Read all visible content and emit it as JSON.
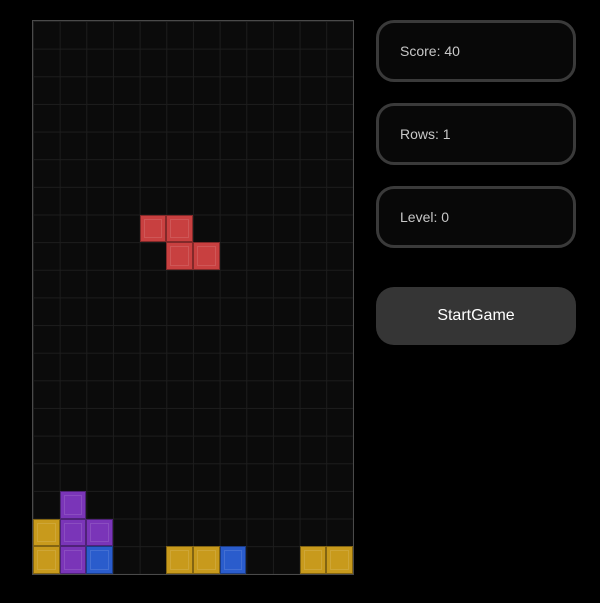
{
  "board": {
    "columns": 12,
    "rows": 20,
    "grid_lines": true,
    "active_piece": {
      "shape": "Z",
      "color": "#c84040",
      "cells": [
        [
          4,
          7
        ],
        [
          5,
          7
        ],
        [
          5,
          8
        ],
        [
          6,
          8
        ]
      ]
    },
    "settled_cells": [
      {
        "col": 1,
        "row": 17,
        "color": "#7a35b8"
      },
      {
        "col": 0,
        "row": 18,
        "color": "#c89a1c"
      },
      {
        "col": 1,
        "row": 18,
        "color": "#7a35b8"
      },
      {
        "col": 2,
        "row": 18,
        "color": "#7a35b8"
      },
      {
        "col": 0,
        "row": 19,
        "color": "#c89a1c"
      },
      {
        "col": 1,
        "row": 19,
        "color": "#7a35b8"
      },
      {
        "col": 2,
        "row": 19,
        "color": "#2a5ccc"
      },
      {
        "col": 5,
        "row": 19,
        "color": "#c89a1c"
      },
      {
        "col": 6,
        "row": 19,
        "color": "#c89a1c"
      },
      {
        "col": 7,
        "row": 19,
        "color": "#2a5ccc"
      },
      {
        "col": 10,
        "row": 19,
        "color": "#c89a1c"
      },
      {
        "col": 11,
        "row": 19,
        "color": "#c89a1c"
      }
    ]
  },
  "stats": {
    "score": "Score: 40",
    "rows": "Rows: 1",
    "level": "Level: 0"
  },
  "controls": {
    "start_label": "StartGame"
  }
}
